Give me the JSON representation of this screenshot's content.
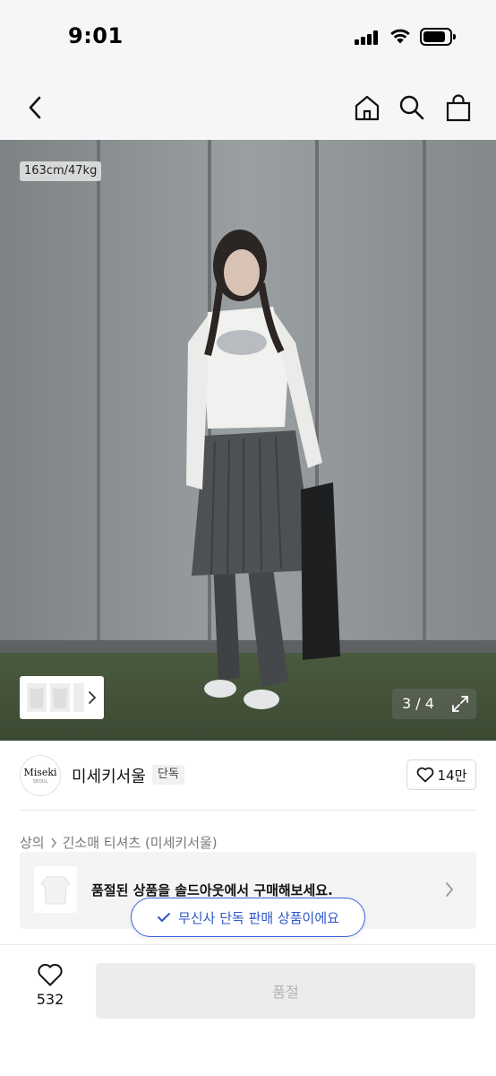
{
  "status_bar": {
    "time": "9:01",
    "signal_icon": "cellular-signal-icon",
    "wifi_icon": "wifi-icon",
    "battery_icon": "battery-icon",
    "battery_level": 0.75
  },
  "nav": {
    "back_icon": "chevron-left-icon",
    "home_icon": "home-icon",
    "search_icon": "search-icon",
    "cart_icon": "shopping-bag-icon"
  },
  "hero": {
    "size_tag": "163cm/47kg",
    "counter": "3 / 4",
    "expand_icon": "expand-icon",
    "thumbnail_arrow_icon": "chevron-right-icon"
  },
  "brand": {
    "logo_text": "Miseki",
    "logo_subtext": "SEOUL",
    "name": "미세키서울",
    "badge": "단독",
    "like_count": "14만"
  },
  "breadcrumb": {
    "category": "상의",
    "subcategory": "긴소매 티셔츠 (미세키서울)"
  },
  "soldout_banner": {
    "text": "품절된 상품을 솔드아웃에서 구매해보세요."
  },
  "toast": {
    "text": "무신사 단독 판매 상품이에요"
  },
  "bottom_bar": {
    "wish_count": "532",
    "buy_label": "품절"
  },
  "colors": {
    "accent_blue": "#2f57c9",
    "background_gray": "#f6f6f6",
    "disabled_button": "#ececec"
  }
}
